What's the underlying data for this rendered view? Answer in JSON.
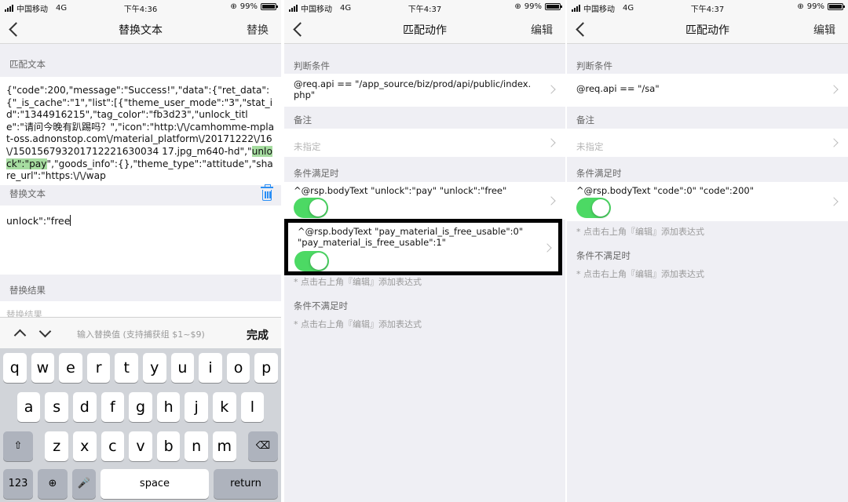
{
  "status": [
    {
      "carrier": "中国移动",
      "network": "4G",
      "time": "下午4:36",
      "battery": "99%"
    },
    {
      "carrier": "中国移动",
      "network": "4G",
      "time": "下午4:37",
      "battery": "99%"
    },
    {
      "carrier": "中国移动",
      "network": "4G",
      "time": "下午4:37",
      "battery": "99%"
    }
  ],
  "screen1": {
    "title": "替换文本",
    "action": "替换",
    "match_label": "匹配文本",
    "match_text_before": "{\"code\":200,\"message\":\"Success!\",\"data\":{\"ret_data\":{\"_is_cache\":\"1\",\"list\":[{\"theme_user_mode\":\"3\",\"stat_id\":\"1344916215\",\"tag_color\":\"fb3d23\",\"unlock_title\":\"请问今晚有趴踢吗？\",\"icon\":\"http:\\/\\/camhomme-mplat-oss.adnonstop.com\\/material_platform\\/20171222\\/16\\/150156793201712221630034 17.jpg_m640-hd\",\"",
    "match_highlight": "unlock\":\"pay",
    "match_text_after": "\",\"goods_info\":{},\"theme_type\":\"attitude\",\"share_url\":\"https:\\/\\/wap",
    "replace_label": "替换文本",
    "replace_value": "unlock\":\"free",
    "result_label": "替换结果",
    "result_placeholder": "替换结果",
    "accessory_hint": "输入替换值 (支持捕获组 $1~$9)",
    "accessory_done": "完成",
    "keyboard": {
      "row1": [
        "q",
        "w",
        "e",
        "r",
        "t",
        "y",
        "u",
        "i",
        "o",
        "p"
      ],
      "row2": [
        "a",
        "s",
        "d",
        "f",
        "g",
        "h",
        "j",
        "k",
        "l"
      ],
      "row3": [
        "z",
        "x",
        "c",
        "v",
        "b",
        "n",
        "m"
      ],
      "numbers": "123",
      "space": "space",
      "return": "return"
    }
  },
  "screen2": {
    "title": "匹配动作",
    "action": "编辑",
    "cond_label": "判断条件",
    "cond_value": "@req.api == \"/app_source/biz/prod/api/public/index.php\"",
    "note_label": "备注",
    "note_placeholder": "未指定",
    "met_label": "条件满足时",
    "met_rules": [
      {
        "text": "^@rsp.bodyText \"unlock\":\"pay\" \"unlock\":\"free\"",
        "enabled": true
      },
      {
        "text": "^@rsp.bodyText \"pay_material_is_free_usable\":0\" \"pay_material_is_free_usable\":1\"",
        "enabled": true
      }
    ],
    "hint1": "* 点击右上角『编辑』添加表达式",
    "unmet_label": "条件不满足时",
    "hint2": "* 点击右上角『编辑』添加表达式"
  },
  "screen3": {
    "title": "匹配动作",
    "action": "编辑",
    "cond_label": "判断条件",
    "cond_value": "@req.api == \"/sa\"",
    "note_label": "备注",
    "note_placeholder": "未指定",
    "met_label": "条件满足时",
    "met_rules": [
      {
        "text": "^@rsp.bodyText \"code\":0\" \"code\":200\"",
        "enabled": true
      }
    ],
    "hint1": "* 点击右上角『编辑』添加表达式",
    "unmet_label": "条件不满足时",
    "hint2": "* 点击右上角『编辑』添加表达式"
  },
  "colors": {
    "toggle_on": "#4cd964",
    "highlight": "#a6dca0",
    "trash": "#2b8ff5"
  }
}
